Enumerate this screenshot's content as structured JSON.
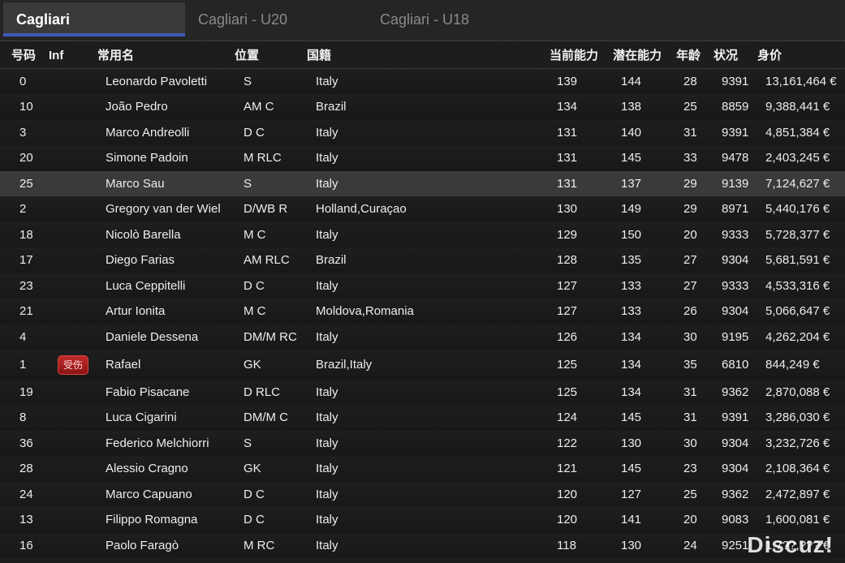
{
  "tabs": [
    "Cagliari",
    "Cagliari - U20",
    "Cagliari - U18"
  ],
  "columns": {
    "number": "号码",
    "inf": "Inf",
    "name": "常用名",
    "position": "位置",
    "nationality": "国籍",
    "current_ability": "当前能力",
    "potential_ability": "潜在能力",
    "age": "年龄",
    "condition": "状况",
    "value": "身价"
  },
  "players": [
    {
      "number": "0",
      "inf": "",
      "name": "Leonardo Pavoletti",
      "position": "S",
      "nationality": "Italy",
      "ca": "139",
      "pa": "144",
      "age": "28",
      "condition": "9391",
      "value": "13,161,464 €"
    },
    {
      "number": "10",
      "inf": "",
      "name": "João Pedro",
      "position": "AM C",
      "nationality": "Brazil",
      "ca": "134",
      "pa": "138",
      "age": "25",
      "condition": "8859",
      "value": "9,388,441 €"
    },
    {
      "number": "3",
      "inf": "",
      "name": "Marco Andreolli",
      "position": "D C",
      "nationality": "Italy",
      "ca": "131",
      "pa": "140",
      "age": "31",
      "condition": "9391",
      "value": "4,851,384 €"
    },
    {
      "number": "20",
      "inf": "",
      "name": "Simone Padoin",
      "position": "M RLC",
      "nationality": "Italy",
      "ca": "131",
      "pa": "145",
      "age": "33",
      "condition": "9478",
      "value": "2,403,245 €"
    },
    {
      "number": "25",
      "inf": "",
      "name": "Marco Sau",
      "position": "S",
      "nationality": "Italy",
      "ca": "131",
      "pa": "137",
      "age": "29",
      "condition": "9139",
      "value": "7,124,627 €"
    },
    {
      "number": "2",
      "inf": "",
      "name": "Gregory van der Wiel",
      "position": "D/WB R",
      "nationality": "Holland,Curaçao",
      "ca": "130",
      "pa": "149",
      "age": "29",
      "condition": "8971",
      "value": "5,440,176 €"
    },
    {
      "number": "18",
      "inf": "",
      "name": "Nicolò Barella",
      "position": "M C",
      "nationality": "Italy",
      "ca": "129",
      "pa": "150",
      "age": "20",
      "condition": "9333",
      "value": "5,728,377 €"
    },
    {
      "number": "17",
      "inf": "",
      "name": "Diego Farias",
      "position": "AM RLC",
      "nationality": "Brazil",
      "ca": "128",
      "pa": "135",
      "age": "27",
      "condition": "9304",
      "value": "5,681,591 €"
    },
    {
      "number": "23",
      "inf": "",
      "name": "Luca Ceppitelli",
      "position": "D C",
      "nationality": "Italy",
      "ca": "127",
      "pa": "133",
      "age": "27",
      "condition": "9333",
      "value": "4,533,316 €"
    },
    {
      "number": "21",
      "inf": "",
      "name": "Artur Ionita",
      "position": "M C",
      "nationality": "Moldova,Romania",
      "ca": "127",
      "pa": "133",
      "age": "26",
      "condition": "9304",
      "value": "5,066,647 €"
    },
    {
      "number": "4",
      "inf": "",
      "name": "Daniele Dessena",
      "position": "DM/M RC",
      "nationality": "Italy",
      "ca": "126",
      "pa": "134",
      "age": "30",
      "condition": "9195",
      "value": "4,262,204 €"
    },
    {
      "number": "1",
      "inf": "受伤",
      "name": "Rafael",
      "position": "GK",
      "nationality": "Brazil,Italy",
      "ca": "125",
      "pa": "134",
      "age": "35",
      "condition": "6810",
      "value": "844,249 €"
    },
    {
      "number": "19",
      "inf": "",
      "name": "Fabio Pisacane",
      "position": "D RLC",
      "nationality": "Italy",
      "ca": "125",
      "pa": "134",
      "age": "31",
      "condition": "9362",
      "value": "2,870,088 €"
    },
    {
      "number": "8",
      "inf": "",
      "name": "Luca Cigarini",
      "position": "DM/M C",
      "nationality": "Italy",
      "ca": "124",
      "pa": "145",
      "age": "31",
      "condition": "9391",
      "value": "3,286,030 €"
    },
    {
      "number": "36",
      "inf": "",
      "name": "Federico Melchiorri",
      "position": "S",
      "nationality": "Italy",
      "ca": "122",
      "pa": "130",
      "age": "30",
      "condition": "9304",
      "value": "3,232,726 €"
    },
    {
      "number": "28",
      "inf": "",
      "name": "Alessio Cragno",
      "position": "GK",
      "nationality": "Italy",
      "ca": "121",
      "pa": "145",
      "age": "23",
      "condition": "9304",
      "value": "2,108,364 €"
    },
    {
      "number": "24",
      "inf": "",
      "name": "Marco Capuano",
      "position": "D C",
      "nationality": "Italy",
      "ca": "120",
      "pa": "127",
      "age": "25",
      "condition": "9362",
      "value": "2,472,897 €"
    },
    {
      "number": "13",
      "inf": "",
      "name": "Filippo Romagna",
      "position": "D C",
      "nationality": "Italy",
      "ca": "120",
      "pa": "141",
      "age": "20",
      "condition": "9083",
      "value": "1,600,081 €"
    },
    {
      "number": "16",
      "inf": "",
      "name": "Paolo Faragò",
      "position": "M RC",
      "nationality": "Italy",
      "ca": "118",
      "pa": "130",
      "age": "24",
      "condition": "9251",
      "value": "1,7??,??? €"
    }
  ],
  "highlighted_row": 4,
  "watermark": "Discuz!",
  "colors": {
    "accent": "#3e59b8",
    "injury_badge": "#b01f1f",
    "row_highlight": "#3a3a3a"
  }
}
